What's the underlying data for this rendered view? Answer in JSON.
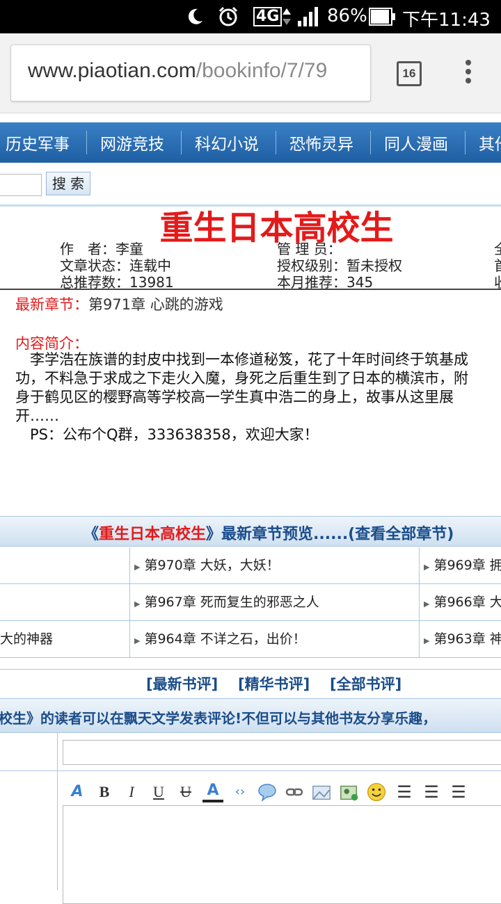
{
  "status_bar": {
    "network": "4G",
    "battery": "86%",
    "time": "下午11:43"
  },
  "browser": {
    "url_domain": "www.piaotian.com",
    "url_path": "/bookinfo/7/79",
    "tab_count": "16"
  },
  "nav": {
    "items": [
      "历史军事",
      "网游竞技",
      "科幻小说",
      "恐怖灵异",
      "同人漫画",
      "其他"
    ]
  },
  "search": {
    "button_label": "搜 索"
  },
  "book": {
    "title": "重生日本高校生",
    "author_label": "作　者：",
    "author": "李童",
    "admin_label": "管 理 员：",
    "admin": "",
    "status_label": "文章状态：",
    "status": "连载中",
    "license_label": "授权级别：",
    "license": "暂未授权",
    "total_rec_label": "总推荐数：",
    "total_rec": "13981",
    "month_rec_label": "本月推荐：",
    "month_rec": "345",
    "col3_row1": "全",
    "col3_row2": "首",
    "col3_row3": "收"
  },
  "latest": {
    "label": "最新章节：",
    "chapter": "第971章 心跳的游戏"
  },
  "intro": {
    "label": "内容简介：",
    "paragraph1": "　李学浩在族谱的封皮中找到一本修道秘笈，花了十年时间终于筑基成功，不料急于求成之下走火入魔，身死之后重生到了日本的横滨市，附身于鹤见区的樱野高等学校高一学生真中浩二的身上，故事从这里展开……",
    "paragraph2": "　PS：公布个Q群，333638358，欢迎大家！"
  },
  "preview": {
    "open_bracket": "《",
    "book_title": "重生日本高校生",
    "close_text": "》最新章节预览......(查看全部章节)"
  },
  "chapters": [
    [
      "",
      "第970章 大妖，大妖！",
      "第969章 拥"
    ],
    [
      "",
      "第967章 死而复生的邪恶之人",
      "第966章 大"
    ],
    [
      "大的神器",
      "第964章 不详之石，出价！",
      "第963章 神"
    ]
  ],
  "reviews": {
    "latest": "[最新书评]",
    "best": "[精华书评]",
    "all": "[全部书评]"
  },
  "comment_banner": "校生》的读者可以在飘天文学发表评论!不但可以与其他书友分享乐趣，"
}
